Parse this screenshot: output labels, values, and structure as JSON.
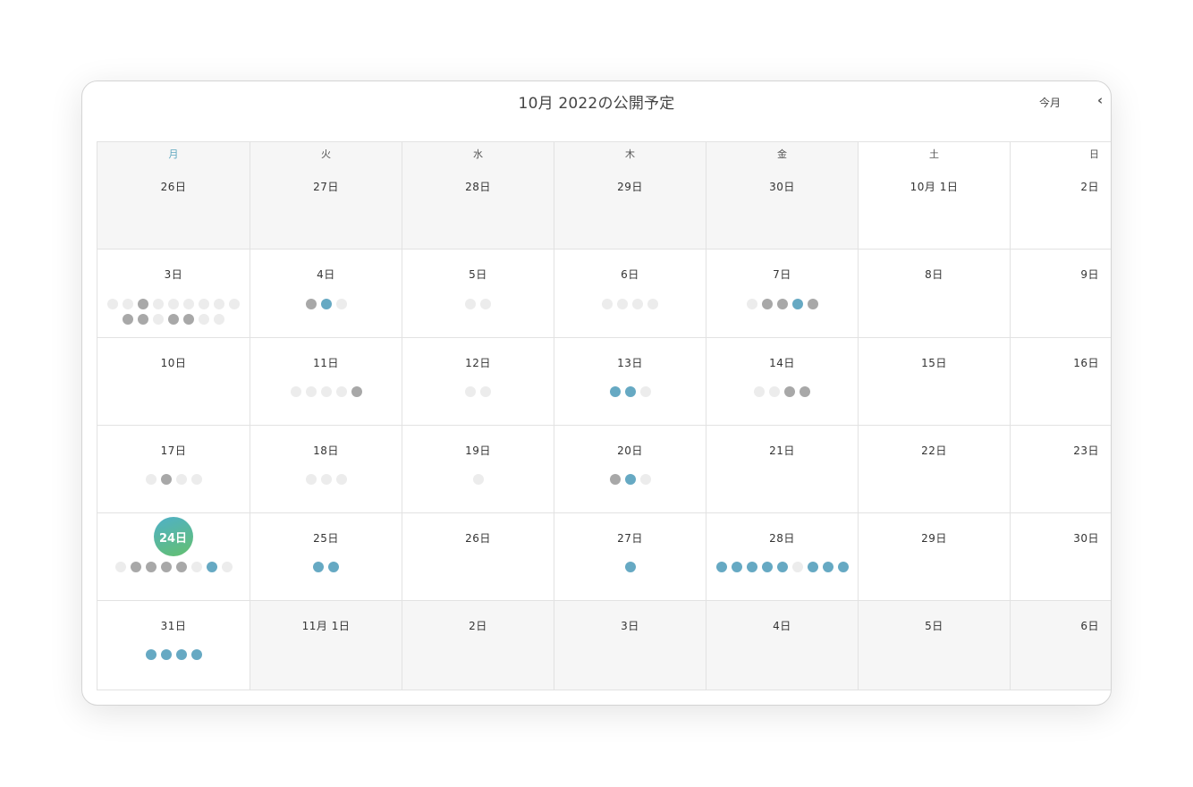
{
  "header": {
    "title": "10月 2022の公開予定",
    "today_label": "今月",
    "prev_label": "‹"
  },
  "colors": {
    "accent_blue": "#66a9c3",
    "gray_dot": "#a8a8a8",
    "empty_dot": "#ececec",
    "today_gradient_start": "#4fb0c8",
    "today_gradient_end": "#64c06f",
    "out_of_month_bg": "#f6f6f6"
  },
  "weekdays": [
    "月",
    "火",
    "水",
    "木",
    "金",
    "土",
    "日"
  ],
  "weeks": [
    {
      "days": [
        {
          "label": "26日",
          "out": true,
          "dots": []
        },
        {
          "label": "27日",
          "out": true,
          "dots": []
        },
        {
          "label": "28日",
          "out": true,
          "dots": []
        },
        {
          "label": "29日",
          "out": true,
          "dots": []
        },
        {
          "label": "30日",
          "out": true,
          "dots": []
        },
        {
          "label": "10月 1日",
          "out": false,
          "dots": []
        },
        {
          "label": "2日",
          "out": false,
          "dots": []
        }
      ]
    },
    {
      "days": [
        {
          "label": "3日",
          "out": false,
          "dots": [
            "empty",
            "empty",
            "gray",
            "empty",
            "empty",
            "empty",
            "empty",
            "empty",
            "empty",
            "gray",
            "gray",
            "empty",
            "gray",
            "gray",
            "empty",
            "empty"
          ]
        },
        {
          "label": "4日",
          "out": false,
          "dots": [
            "gray",
            "blue",
            "empty"
          ]
        },
        {
          "label": "5日",
          "out": false,
          "dots": [
            "empty",
            "empty"
          ]
        },
        {
          "label": "6日",
          "out": false,
          "dots": [
            "empty",
            "empty",
            "empty",
            "empty"
          ]
        },
        {
          "label": "7日",
          "out": false,
          "dots": [
            "empty",
            "gray",
            "gray",
            "blue",
            "gray"
          ]
        },
        {
          "label": "8日",
          "out": false,
          "dots": []
        },
        {
          "label": "9日",
          "out": false,
          "dots": []
        }
      ]
    },
    {
      "days": [
        {
          "label": "10日",
          "out": false,
          "dots": []
        },
        {
          "label": "11日",
          "out": false,
          "dots": [
            "empty",
            "empty",
            "empty",
            "empty",
            "gray"
          ]
        },
        {
          "label": "12日",
          "out": false,
          "dots": [
            "empty",
            "empty"
          ]
        },
        {
          "label": "13日",
          "out": false,
          "dots": [
            "blue",
            "blue",
            "empty"
          ]
        },
        {
          "label": "14日",
          "out": false,
          "dots": [
            "empty",
            "empty",
            "gray",
            "gray"
          ]
        },
        {
          "label": "15日",
          "out": false,
          "dots": []
        },
        {
          "label": "16日",
          "out": false,
          "dots": []
        }
      ]
    },
    {
      "days": [
        {
          "label": "17日",
          "out": false,
          "dots": [
            "empty",
            "gray",
            "empty",
            "empty"
          ]
        },
        {
          "label": "18日",
          "out": false,
          "dots": [
            "empty",
            "empty",
            "empty"
          ]
        },
        {
          "label": "19日",
          "out": false,
          "dots": [
            "empty"
          ]
        },
        {
          "label": "20日",
          "out": false,
          "dots": [
            "gray",
            "blue",
            "empty"
          ]
        },
        {
          "label": "21日",
          "out": false,
          "dots": []
        },
        {
          "label": "22日",
          "out": false,
          "dots": []
        },
        {
          "label": "23日",
          "out": false,
          "dots": []
        }
      ]
    },
    {
      "days": [
        {
          "label": "24日",
          "out": false,
          "today": true,
          "dots": [
            "empty",
            "gray",
            "gray",
            "gray",
            "gray",
            "empty",
            "blue",
            "empty"
          ]
        },
        {
          "label": "25日",
          "out": false,
          "dots": [
            "blue",
            "blue"
          ]
        },
        {
          "label": "26日",
          "out": false,
          "dots": []
        },
        {
          "label": "27日",
          "out": false,
          "dots": [
            "blue"
          ]
        },
        {
          "label": "28日",
          "out": false,
          "dots": [
            "blue",
            "blue",
            "blue",
            "blue",
            "blue",
            "empty",
            "blue",
            "blue",
            "blue"
          ]
        },
        {
          "label": "29日",
          "out": false,
          "dots": []
        },
        {
          "label": "30日",
          "out": false,
          "dots": []
        }
      ]
    },
    {
      "days": [
        {
          "label": "31日",
          "out": false,
          "dots": [
            "blue",
            "blue",
            "blue",
            "blue"
          ]
        },
        {
          "label": "11月 1日",
          "out": true,
          "dots": []
        },
        {
          "label": "2日",
          "out": true,
          "dots": []
        },
        {
          "label": "3日",
          "out": true,
          "dots": []
        },
        {
          "label": "4日",
          "out": true,
          "dots": []
        },
        {
          "label": "5日",
          "out": true,
          "dots": []
        },
        {
          "label": "6日",
          "out": true,
          "dots": []
        }
      ]
    }
  ]
}
